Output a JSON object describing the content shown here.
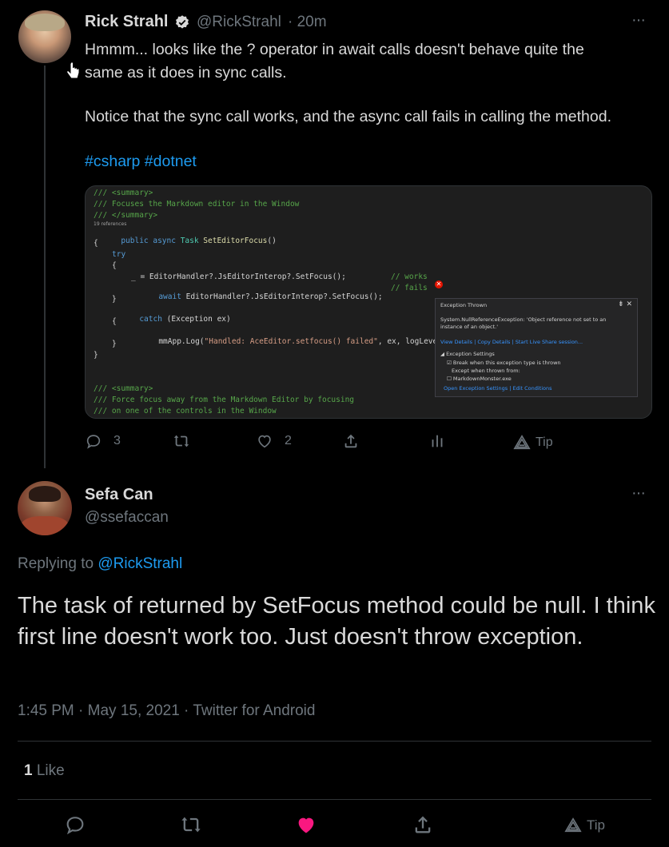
{
  "tweet1": {
    "name": "Rick Strahl",
    "handle": "@RickStrahl",
    "time": "· 20m",
    "more": "···",
    "text_line1": "Hmmm... looks like the ? operator in await calls doesn't behave quite the",
    "text_line2": "same as it does in sync calls.",
    "text_line3": "Notice that the sync call works, and the async call fails in calling the method.",
    "hashtags": "#csharp #dotnet",
    "replies": "3",
    "likes": "2",
    "tip": "Tip",
    "code": {
      "l1": "/// <summary>",
      "l2": "/// Focuses the Markdown editor in the Window",
      "l3": "/// </summary>",
      "refs": "19 references",
      "l4a": "public async ",
      "l4b": "Task ",
      "l4c": "SetEditorFocus",
      "l4d": "()",
      "l5": "{",
      "l6": "try",
      "l7": "{",
      "l8": "_ = EditorHandler?.JsEditorInterop?.SetFocus();",
      "l8c": "// works",
      "l9a": "await ",
      "l9b": "EditorHandler?.JsEditorInterop?.SetFocus();",
      "l9c": "// fails",
      "l10": "}",
      "l11a": "catch ",
      "l11b": "(Exception ex)",
      "l12": "{",
      "l13a": "mmApp.Log(",
      "l13b": "\"Handled: AceEditor.setfocus() failed\"",
      "l13c": ", ex, logLevel:",
      "l14": "}",
      "l15": "}",
      "l16": "/// <summary>",
      "l17": "/// Force focus away from the Markdown Editor by focusing",
      "l18": "/// on one of the controls in the Window",
      "exc_title": "Exception Thrown",
      "exc_ctl": "⇟ ✕",
      "exc_msg": "System.NullReferenceException: 'Object reference not set to an instance of an object.'",
      "exc_links": "View Details | Copy Details | Start Live Share session...",
      "exc_settings": "◢ Exception Settings",
      "exc_break": "☑ Break when this exception type is thrown",
      "exc_except": "Except when thrown from:",
      "exc_mm": "☐ MarkdownMonster.exe",
      "exc_links2": "Open Exception Settings | Edit Conditions",
      "err_glyph": "✕"
    }
  },
  "tweet2": {
    "name": "Sefa Can",
    "handle": "@ssefaccan",
    "more": "···",
    "replying_prefix": "Replying to ",
    "replying_to": "@RickStrahl",
    "text": "The task of returned by SetFocus method could be null. I think first line doesn't work too. Just doesn't throw exception.",
    "meta": "1:45 PM · May 15, 2021 · Twitter for Android",
    "like_count": "1",
    "like_label": " Like",
    "tip": "Tip"
  },
  "colors": {
    "accent": "#1d9bf0",
    "like_active": "#f91880",
    "muted": "#6e767d"
  },
  "icons": [
    "reply-icon",
    "retweet-icon",
    "like-icon",
    "share-icon",
    "analytics-icon",
    "tip-icon",
    "verified-icon",
    "more-icon",
    "cursor-icon"
  ]
}
